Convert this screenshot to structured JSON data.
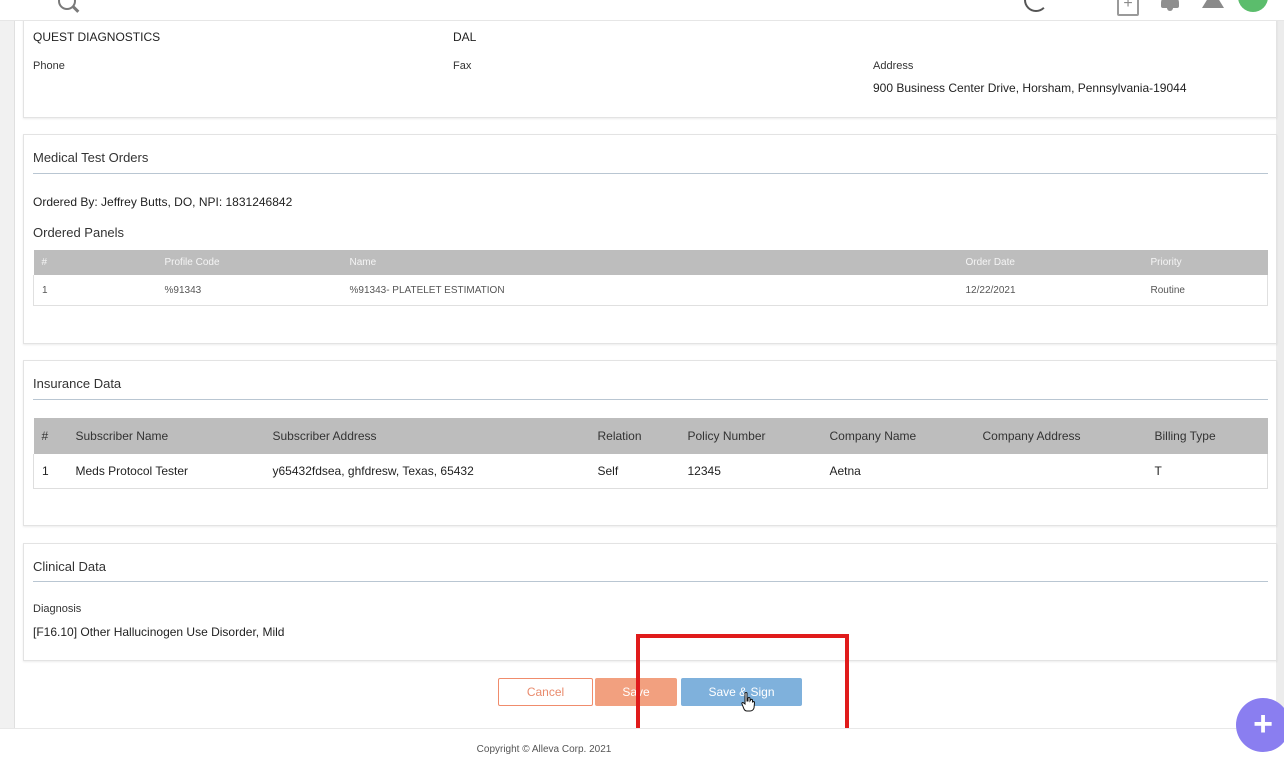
{
  "lab": {
    "name": "QUEST DIAGNOSTICS",
    "code": "DAL",
    "phone_label": "Phone",
    "fax_label": "Fax",
    "address_label": "Address",
    "address": "900 Business Center Drive, Horsham, Pennsylvania-19044"
  },
  "orders": {
    "title": "Medical Test Orders",
    "ordered_by": "Ordered By: Jeffrey Butts, DO, NPI: 1831246842",
    "panels_title": "Ordered Panels",
    "columns": [
      "#",
      "Profile Code",
      "Name",
      "Order Date",
      "Priority"
    ],
    "rows": [
      [
        "1",
        "%91343",
        "%91343- PLATELET ESTIMATION",
        "12/22/2021",
        "Routine"
      ]
    ]
  },
  "insurance": {
    "title": "Insurance Data",
    "columns": [
      "#",
      "Subscriber Name",
      "Subscriber Address",
      "Relation",
      "Policy Number",
      "Company Name",
      "Company Address",
      "Billing Type"
    ],
    "rows": [
      [
        "1",
        "Meds Protocol Tester",
        "y65432fdsea, ghfdresw, Texas, 65432",
        "Self",
        "12345",
        "Aetna",
        "",
        "T"
      ]
    ]
  },
  "clinical": {
    "title": "Clinical Data",
    "diagnosis_label": "Diagnosis",
    "diagnosis": "[F16.10] Other Hallucinogen Use Disorder, Mild"
  },
  "buttons": {
    "cancel": "Cancel",
    "save": "Save",
    "save_sign": "Save & Sign"
  },
  "footer": {
    "copyright": "Copyright © Alleva Corp. 2021"
  },
  "colors": {
    "cancel_border": "#f08c6c",
    "save_bg": "#f2a07f",
    "save_sign_bg": "#7fb1dc",
    "highlight": "#e01b1b",
    "fab": "#8a7ef0"
  },
  "icons": [
    "search-icon",
    "loading-icon",
    "add-document-icon",
    "bell-icon",
    "alert-icon",
    "user-avatar",
    "plus-icon",
    "hand-cursor-icon"
  ]
}
